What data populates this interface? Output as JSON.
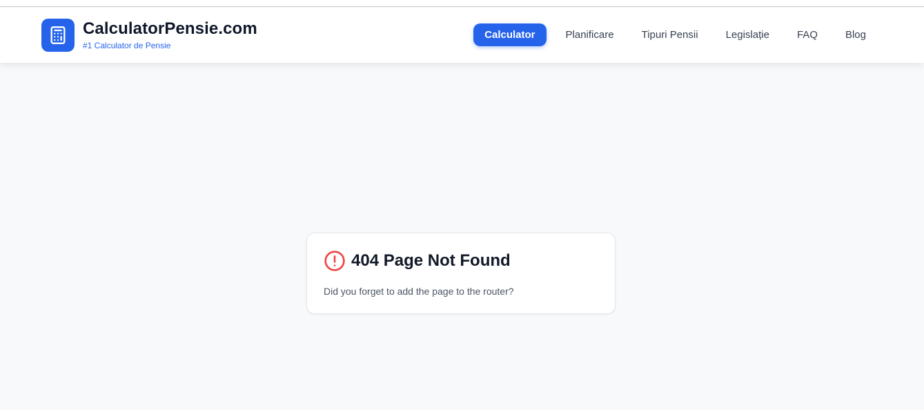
{
  "header": {
    "brand_name": "CalculatorPensie.com",
    "tagline": "#1 Calculator de Pensie",
    "logo_icon": "calculator-icon"
  },
  "nav": {
    "items": [
      {
        "label": "Calculator",
        "active": true
      },
      {
        "label": "Planificare",
        "active": false
      },
      {
        "label": "Tipuri Pensii",
        "active": false
      },
      {
        "label": "Legislație",
        "active": false
      },
      {
        "label": "FAQ",
        "active": false
      },
      {
        "label": "Blog",
        "active": false
      }
    ]
  },
  "error_card": {
    "icon": "alert-circle-icon",
    "title": "404 Page Not Found",
    "message": "Did you forget to add the page to the router?"
  },
  "colors": {
    "accent": "#2563eb",
    "error": "#ef4444",
    "background": "#f8f9fb"
  }
}
